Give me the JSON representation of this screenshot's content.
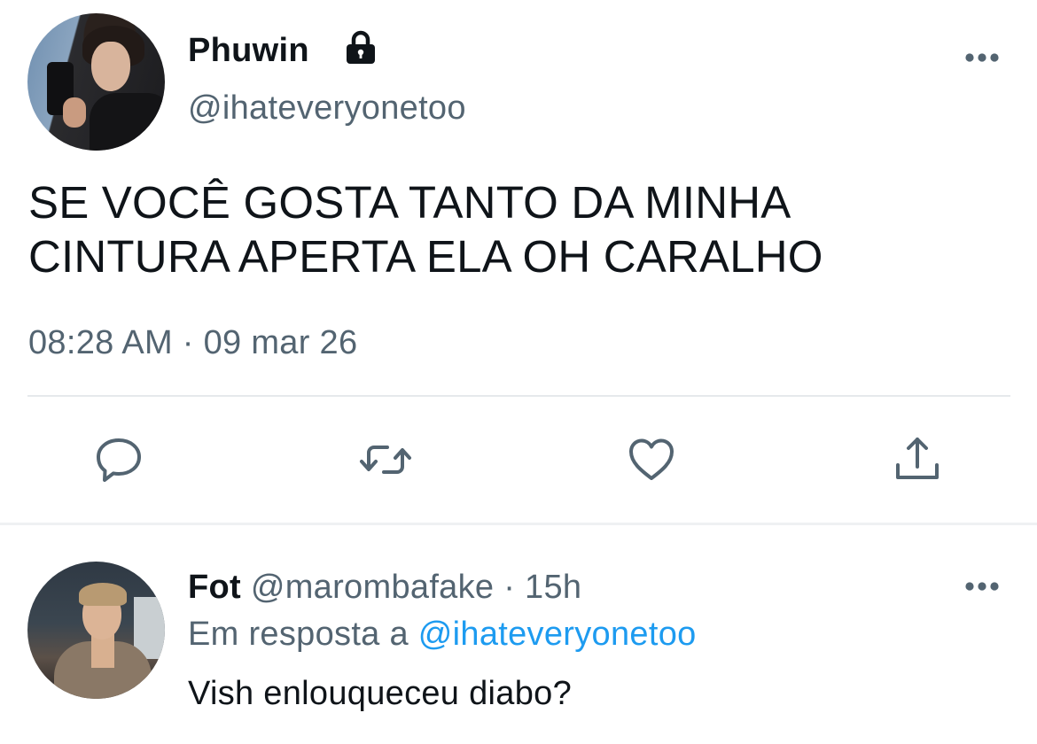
{
  "tweet": {
    "author_name": "Phuwin",
    "author_handle": "@ihateveryonetoo",
    "protected_icon": "lock-icon",
    "text_line1": "SE VOCÊ GOSTA TANTO DA MINHA",
    "text_line2": "CINTURA APERTA ELA OH CARALHO",
    "timestamp": "08:28 AM · 09 mar 26",
    "actions": [
      "reply-icon",
      "retweet-icon",
      "like-icon",
      "share-icon"
    ]
  },
  "reply": {
    "author_name": "Fot",
    "author_handle": "@marombafake",
    "separator": " · ",
    "age": "15h",
    "in_reply_prefix": "Em resposta a ",
    "in_reply_handle": "@ihateveryonetoo",
    "text": "Vish enlouqueceu diabo?"
  },
  "colors": {
    "text": "#0f1419",
    "secondary": "#536471",
    "link": "#1d9bf0",
    "divider": "#e6e9ec"
  }
}
